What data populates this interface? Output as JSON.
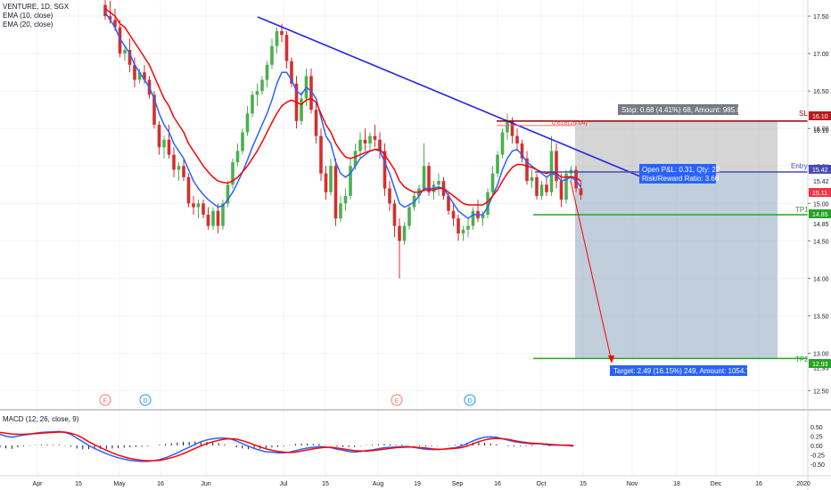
{
  "legend": {
    "symbol": "VENTURE, 1D, SGX",
    "ema10": "EMA (10, close)",
    "ema20": "EMA (20, close)"
  },
  "macd_legend": "MACD (12, 26, close, 9)",
  "colors": {
    "up": "#4caf50",
    "down": "#d32f2f",
    "ema10": "#2962ff",
    "ema20": "#ff0000",
    "trendline": "#2424e8",
    "stop_line": "#990000",
    "entry_line": "#4a4ab5",
    "target_line": "#27a327",
    "risk_zone": "#b2b2b2",
    "reward_zone": "#9fb4c8"
  },
  "annotations": {
    "stop_box": "Stop: 0.68 (4.41%) 68, Amount: 985.04",
    "fib_label": "0.618(16.04)",
    "open_pnl": "Open P&L: 0.31, Qty: 22",
    "risk_reward": "Risk/Reward Ratio: 3.66",
    "target_box": "Target: 2.49 (16.15%) 249, Amount: 1054.78",
    "sl_label": "SL",
    "entry_label": "Entry",
    "tp1_label": "TP1",
    "tp2_label": "TP2",
    "earnings_marker": "E",
    "dividend_marker": "D"
  },
  "price_tags": {
    "sl": "16.10",
    "entry": "15.42",
    "current": "15.11",
    "tp1": "14.85",
    "tp2": "12.93"
  },
  "chart_data": {
    "type": "candlestick",
    "price_axis_ticks": [
      "17.50",
      "17.00",
      "16.50",
      "16.00",
      "15.50",
      "15.00",
      "14.50",
      "14.00",
      "13.50",
      "13.00",
      "12.50"
    ],
    "price_axis_extra_labels": [
      "16.10",
      "15.42",
      "14.85",
      "12.93"
    ],
    "macd_axis_ticks": [
      "0.50",
      "0.25",
      "0.00",
      "-0.25",
      "-0.50"
    ],
    "time_axis_labels": [
      "Apr",
      "15",
      "May",
      "16",
      "Jun",
      "Jul",
      "15",
      "Aug",
      "19",
      "Sep",
      "16",
      "Oct",
      "15",
      "Nov",
      "18",
      "Dec",
      "16",
      "2020"
    ],
    "ylim": [
      12.4,
      17.62
    ],
    "levels": {
      "stop_loss": 16.1,
      "entry": 15.42,
      "tp1": 14.85,
      "tp2": 12.93,
      "current": 15.11,
      "fib_0618": 16.04
    },
    "candles": [
      [
        17.65,
        17.75,
        17.45,
        17.5
      ],
      [
        17.5,
        17.7,
        17.4,
        17.45
      ],
      [
        17.45,
        17.6,
        17.3,
        17.35
      ],
      [
        17.35,
        17.45,
        16.95,
        17.0
      ],
      [
        17.0,
        17.1,
        16.9,
        17.05
      ],
      [
        17.05,
        17.2,
        16.75,
        16.85
      ],
      [
        16.85,
        16.95,
        16.55,
        16.65
      ],
      [
        16.65,
        16.8,
        16.6,
        16.75
      ],
      [
        16.75,
        16.85,
        16.6,
        16.65
      ],
      [
        16.65,
        16.7,
        16.4,
        16.45
      ],
      [
        16.45,
        16.5,
        16.0,
        16.05
      ],
      [
        16.05,
        16.1,
        15.65,
        15.75
      ],
      [
        15.75,
        15.9,
        15.6,
        15.85
      ],
      [
        15.85,
        16.05,
        15.6,
        15.65
      ],
      [
        15.65,
        15.75,
        15.35,
        15.45
      ],
      [
        15.45,
        15.55,
        15.3,
        15.5
      ],
      [
        15.5,
        15.6,
        15.3,
        15.35
      ],
      [
        15.35,
        15.4,
        14.95,
        15.0
      ],
      [
        15.0,
        15.1,
        14.85,
        14.95
      ],
      [
        14.95,
        15.05,
        14.8,
        15.0
      ],
      [
        15.0,
        15.05,
        14.8,
        14.85
      ],
      [
        14.85,
        14.95,
        14.65,
        14.7
      ],
      [
        14.7,
        14.95,
        14.65,
        14.9
      ],
      [
        14.9,
        15.0,
        14.6,
        14.7
      ],
      [
        14.7,
        15.05,
        14.65,
        15.0
      ],
      [
        15.0,
        15.3,
        14.95,
        15.25
      ],
      [
        15.25,
        15.6,
        15.2,
        15.55
      ],
      [
        15.55,
        15.8,
        15.5,
        15.7
      ],
      [
        15.7,
        16.0,
        15.65,
        15.95
      ],
      [
        15.95,
        16.3,
        15.9,
        16.2
      ],
      [
        16.2,
        16.5,
        16.15,
        16.45
      ],
      [
        16.45,
        16.6,
        16.3,
        16.5
      ],
      [
        16.5,
        16.7,
        16.45,
        16.65
      ],
      [
        16.65,
        16.9,
        16.55,
        16.85
      ],
      [
        16.85,
        17.2,
        16.8,
        17.1
      ],
      [
        17.1,
        17.35,
        17.0,
        17.3
      ],
      [
        17.3,
        17.4,
        17.15,
        17.25
      ],
      [
        17.25,
        17.3,
        16.8,
        16.9
      ],
      [
        16.9,
        16.95,
        16.55,
        16.6
      ],
      [
        16.6,
        16.7,
        16.0,
        16.1
      ],
      [
        16.1,
        16.5,
        16.05,
        16.4
      ],
      [
        16.4,
        16.8,
        16.3,
        16.7
      ],
      [
        16.7,
        16.8,
        16.2,
        16.25
      ],
      [
        16.25,
        16.35,
        15.8,
        15.9
      ],
      [
        15.9,
        16.0,
        15.3,
        15.4
      ],
      [
        15.4,
        15.5,
        15.05,
        15.15
      ],
      [
        15.15,
        15.6,
        15.1,
        15.5
      ],
      [
        15.5,
        15.6,
        14.7,
        14.8
      ],
      [
        14.8,
        15.1,
        14.75,
        15.0
      ],
      [
        15.0,
        15.2,
        14.9,
        15.1
      ],
      [
        15.1,
        15.6,
        15.05,
        15.5
      ],
      [
        15.5,
        15.8,
        15.45,
        15.7
      ],
      [
        15.7,
        15.95,
        15.6,
        15.85
      ],
      [
        15.85,
        16.0,
        15.7,
        15.8
      ],
      [
        15.8,
        15.95,
        15.7,
        15.9
      ],
      [
        15.9,
        16.05,
        15.75,
        15.85
      ],
      [
        15.85,
        15.95,
        15.6,
        15.7
      ],
      [
        15.7,
        15.8,
        15.1,
        15.2
      ],
      [
        15.2,
        15.3,
        14.9,
        15.0
      ],
      [
        15.0,
        15.05,
        14.55,
        14.7
      ],
      [
        14.7,
        14.8,
        14.0,
        14.5
      ],
      [
        14.5,
        14.75,
        14.45,
        14.7
      ],
      [
        14.7,
        15.0,
        14.65,
        14.95
      ],
      [
        14.95,
        15.15,
        14.9,
        15.1
      ],
      [
        15.1,
        15.25,
        15.0,
        15.2
      ],
      [
        15.2,
        15.8,
        15.15,
        15.5
      ],
      [
        15.5,
        15.55,
        15.1,
        15.15
      ],
      [
        15.15,
        15.3,
        15.05,
        15.25
      ],
      [
        15.25,
        15.4,
        15.1,
        15.3
      ],
      [
        15.3,
        15.35,
        15.05,
        15.1
      ],
      [
        15.1,
        15.15,
        14.85,
        14.9
      ],
      [
        14.9,
        15.0,
        14.7,
        14.8
      ],
      [
        14.8,
        14.85,
        14.5,
        14.6
      ],
      [
        14.6,
        14.7,
        14.5,
        14.65
      ],
      [
        14.65,
        14.8,
        14.55,
        14.7
      ],
      [
        14.7,
        14.95,
        14.65,
        14.9
      ],
      [
        14.9,
        15.05,
        14.75,
        14.8
      ],
      [
        14.8,
        14.9,
        14.7,
        14.85
      ],
      [
        14.85,
        15.2,
        14.8,
        15.15
      ],
      [
        15.15,
        15.5,
        15.1,
        15.4
      ],
      [
        15.4,
        15.7,
        15.35,
        15.65
      ],
      [
        15.65,
        16.0,
        15.6,
        15.95
      ],
      [
        15.95,
        16.2,
        15.85,
        16.1
      ],
      [
        16.1,
        16.15,
        15.8,
        15.9
      ],
      [
        15.9,
        16.0,
        15.7,
        15.8
      ],
      [
        15.8,
        15.85,
        15.55,
        15.6
      ],
      [
        15.6,
        15.7,
        15.25,
        15.3
      ],
      [
        15.3,
        15.45,
        15.2,
        15.35
      ],
      [
        15.35,
        15.4,
        15.05,
        15.1
      ],
      [
        15.1,
        15.3,
        15.05,
        15.25
      ],
      [
        15.25,
        15.35,
        15.1,
        15.15
      ],
      [
        15.15,
        15.9,
        15.1,
        15.7
      ],
      [
        15.7,
        15.8,
        15.2,
        15.3
      ],
      [
        15.3,
        15.4,
        14.95,
        15.05
      ],
      [
        15.05,
        15.45,
        15.0,
        15.4
      ],
      [
        15.4,
        15.5,
        15.3,
        15.45
      ],
      [
        15.45,
        15.5,
        15.15,
        15.2
      ],
      [
        15.2,
        15.3,
        15.05,
        15.11
      ]
    ],
    "ema10": [
      17.55,
      17.45,
      17.35,
      17.2,
      17.1,
      17.0,
      16.85,
      16.75,
      16.65,
      16.55,
      16.4,
      16.2,
      16.05,
      15.95,
      15.8,
      15.7,
      15.6,
      15.45,
      15.3,
      15.2,
      15.12,
      15.05,
      15.0,
      14.95,
      14.97,
      15.05,
      15.15,
      15.28,
      15.42,
      15.58,
      15.75,
      15.9,
      16.05,
      16.2,
      16.38,
      16.6,
      16.75,
      16.75,
      16.65,
      16.5,
      16.45,
      16.55,
      16.5,
      16.4,
      16.15,
      15.9,
      15.8,
      15.55,
      15.4,
      15.35,
      15.4,
      15.5,
      15.6,
      15.65,
      15.7,
      15.72,
      15.7,
      15.55,
      15.4,
      15.2,
      15.0,
      14.95,
      14.98,
      15.02,
      15.1,
      15.2,
      15.2,
      15.2,
      15.22,
      15.2,
      15.1,
      15.0,
      14.9,
      14.85,
      14.8,
      14.85,
      14.85,
      14.85,
      14.95,
      15.1,
      15.25,
      15.45,
      15.6,
      15.7,
      15.72,
      15.65,
      15.55,
      15.5,
      15.45,
      15.4,
      15.35,
      15.4,
      15.38,
      15.3,
      15.32,
      15.35,
      15.3,
      15.22
    ],
    "ema20": [
      17.6,
      17.55,
      17.5,
      17.4,
      17.35,
      17.25,
      17.15,
      17.05,
      16.95,
      16.85,
      16.7,
      16.55,
      16.4,
      16.3,
      16.15,
      16.05,
      15.95,
      15.8,
      15.7,
      15.6,
      15.5,
      15.42,
      15.35,
      15.3,
      15.28,
      15.27,
      15.3,
      15.35,
      15.42,
      15.5,
      15.6,
      15.7,
      15.82,
      15.95,
      16.08,
      16.2,
      16.3,
      16.35,
      16.38,
      16.35,
      16.32,
      16.38,
      16.4,
      16.35,
      16.2,
      16.05,
      15.95,
      15.8,
      15.7,
      15.62,
      15.6,
      15.62,
      15.65,
      15.68,
      15.7,
      15.72,
      15.72,
      15.65,
      15.55,
      15.45,
      15.3,
      15.22,
      15.18,
      15.15,
      15.15,
      15.18,
      15.18,
      15.18,
      15.2,
      15.2,
      15.15,
      15.1,
      15.05,
      15.0,
      14.98,
      14.98,
      14.98,
      14.98,
      15.02,
      15.1,
      15.18,
      15.3,
      15.4,
      15.48,
      15.52,
      15.52,
      15.5,
      15.48,
      15.45,
      15.42,
      15.4,
      15.42,
      15.4,
      15.35,
      15.35,
      15.36,
      15.34,
      15.3
    ],
    "macd_line": [
      0.3,
      0.25,
      0.22,
      0.25,
      0.28,
      0.3,
      0.33,
      0.35,
      0.36,
      0.37,
      0.38,
      0.35,
      0.3,
      0.2,
      0.1,
      0.0,
      -0.08,
      -0.15,
      -0.22,
      -0.28,
      -0.33,
      -0.37,
      -0.4,
      -0.42,
      -0.43,
      -0.43,
      -0.41,
      -0.38,
      -0.33,
      -0.27,
      -0.2,
      -0.12,
      -0.05,
      0.03,
      0.1,
      0.15,
      0.18,
      0.2,
      0.2,
      0.18,
      0.12,
      0.05,
      -0.02,
      -0.08,
      -0.13,
      -0.17,
      -0.18,
      -0.2,
      -0.2,
      -0.18,
      -0.14,
      -0.1,
      -0.07,
      -0.05,
      -0.03,
      -0.04,
      -0.06,
      -0.1,
      -0.13,
      -0.16,
      -0.18,
      -0.16,
      -0.14,
      -0.12,
      -0.09,
      -0.06,
      -0.05,
      -0.04,
      -0.03,
      -0.03,
      -0.05,
      -0.08,
      -0.1,
      -0.11,
      -0.11,
      -0.1,
      -0.08,
      -0.06,
      -0.02,
      0.05,
      0.12,
      0.18,
      0.22,
      0.23,
      0.22,
      0.18,
      0.14,
      0.1,
      0.08,
      0.06,
      0.04,
      0.05,
      0.03,
      0.01,
      0.01,
      0.01,
      0.0,
      -0.02
    ],
    "signal_line": [
      0.35,
      0.33,
      0.31,
      0.3,
      0.3,
      0.31,
      0.32,
      0.33,
      0.34,
      0.35,
      0.36,
      0.36,
      0.33,
      0.28,
      0.2,
      0.1,
      0.02,
      -0.06,
      -0.13,
      -0.2,
      -0.26,
      -0.31,
      -0.35,
      -0.38,
      -0.4,
      -0.41,
      -0.41,
      -0.4,
      -0.37,
      -0.33,
      -0.28,
      -0.22,
      -0.15,
      -0.08,
      -0.01,
      0.05,
      0.1,
      0.14,
      0.17,
      0.18,
      0.17,
      0.13,
      0.08,
      0.02,
      -0.04,
      -0.09,
      -0.13,
      -0.16,
      -0.18,
      -0.19,
      -0.18,
      -0.15,
      -0.12,
      -0.09,
      -0.07,
      -0.05,
      -0.05,
      -0.07,
      -0.09,
      -0.12,
      -0.14,
      -0.15,
      -0.15,
      -0.14,
      -0.12,
      -0.1,
      -0.08,
      -0.06,
      -0.05,
      -0.04,
      -0.04,
      -0.06,
      -0.07,
      -0.09,
      -0.1,
      -0.1,
      -0.09,
      -0.08,
      -0.06,
      -0.02,
      0.04,
      0.1,
      0.15,
      0.18,
      0.19,
      0.18,
      0.16,
      0.13,
      0.1,
      0.08,
      0.06,
      0.05,
      0.04,
      0.03,
      0.02,
      0.01,
      0.01,
      0.0
    ],
    "macd_ylim": [
      -0.6,
      0.6
    ]
  }
}
